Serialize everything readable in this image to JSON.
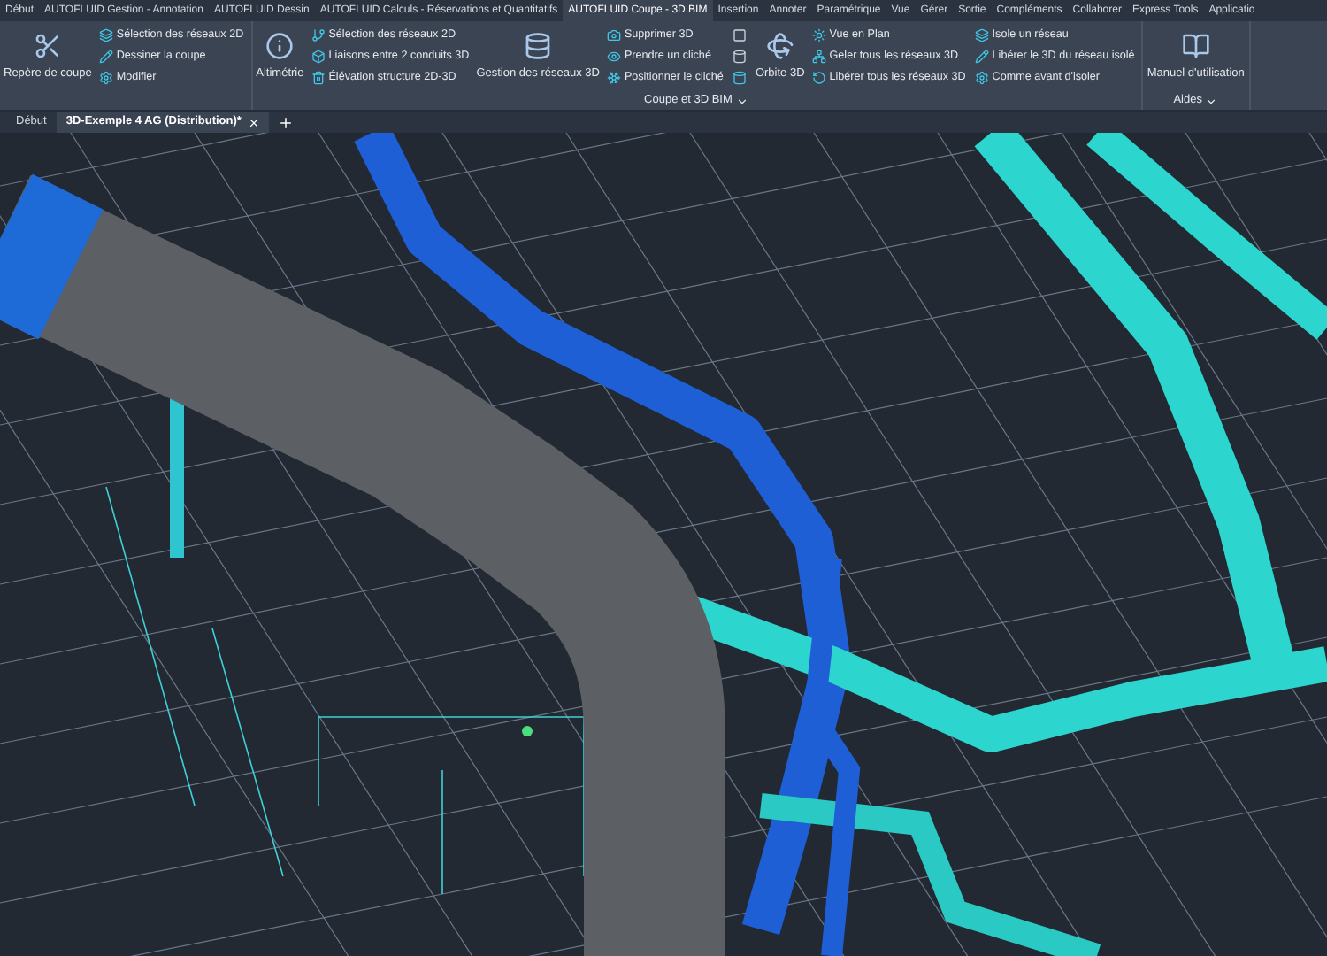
{
  "ribbon_tabs": [
    {
      "label": "Début",
      "selected": false
    },
    {
      "label": "AUTOFLUID Gestion - Annotation",
      "selected": false
    },
    {
      "label": "AUTOFLUID Dessin",
      "selected": false
    },
    {
      "label": "AUTOFLUID Calculs - Réservations et Quantitatifs",
      "selected": false
    },
    {
      "label": "AUTOFLUID Coupe - 3D BIM",
      "selected": true
    },
    {
      "label": "Insertion",
      "selected": false
    },
    {
      "label": "Annoter",
      "selected": false
    },
    {
      "label": "Paramétrique",
      "selected": false
    },
    {
      "label": "Vue",
      "selected": false
    },
    {
      "label": "Gérer",
      "selected": false
    },
    {
      "label": "Sortie",
      "selected": false
    },
    {
      "label": "Compléments",
      "selected": false
    },
    {
      "label": "Collaborer",
      "selected": false
    },
    {
      "label": "Express Tools",
      "selected": false
    },
    {
      "label": "Applicatio",
      "selected": false
    }
  ],
  "ribbon": {
    "panels": [
      {
        "groups": [
          {
            "kind": "large",
            "label": "Repère de coupe"
          },
          {
            "kind": "small",
            "items": [
              "Sélection des réseaux 2D",
              "Dessiner la coupe",
              "Modifier"
            ]
          }
        ]
      },
      {
        "title": "Coupe et 3D BIM",
        "groups": [
          {
            "kind": "large",
            "label": "Altimétrie"
          },
          {
            "kind": "small",
            "items": [
              "Sélection des réseaux 2D",
              "Liaisons entre 2 conduits 3D",
              "Élévation structure 2D-3D"
            ]
          },
          {
            "kind": "large",
            "label": "Gestion des réseaux 3D"
          },
          {
            "kind": "small",
            "items": [
              "Supprimer 3D",
              "Prendre un cliché",
              "Positionner le cliché"
            ]
          },
          {
            "kind": "icons"
          },
          {
            "kind": "large",
            "label": "Orbite 3D"
          },
          {
            "kind": "small",
            "items": [
              "Vue en Plan",
              "Geler tous les réseaux 3D",
              "Libérer tous les réseaux 3D"
            ]
          },
          {
            "kind": "small",
            "items": [
              "Isole un réseau",
              "Libérer le 3D du réseau isolé",
              "Comme avant d'isoler"
            ]
          }
        ]
      },
      {
        "title": "Aides",
        "groups": [
          {
            "kind": "large",
            "label": "Manuel d'utilisation"
          }
        ]
      }
    ]
  },
  "doc_tabs": [
    {
      "label": "Début",
      "selected": false
    },
    {
      "label": "3D-Exemple 4 AG (Distribution)*",
      "selected": true
    }
  ]
}
